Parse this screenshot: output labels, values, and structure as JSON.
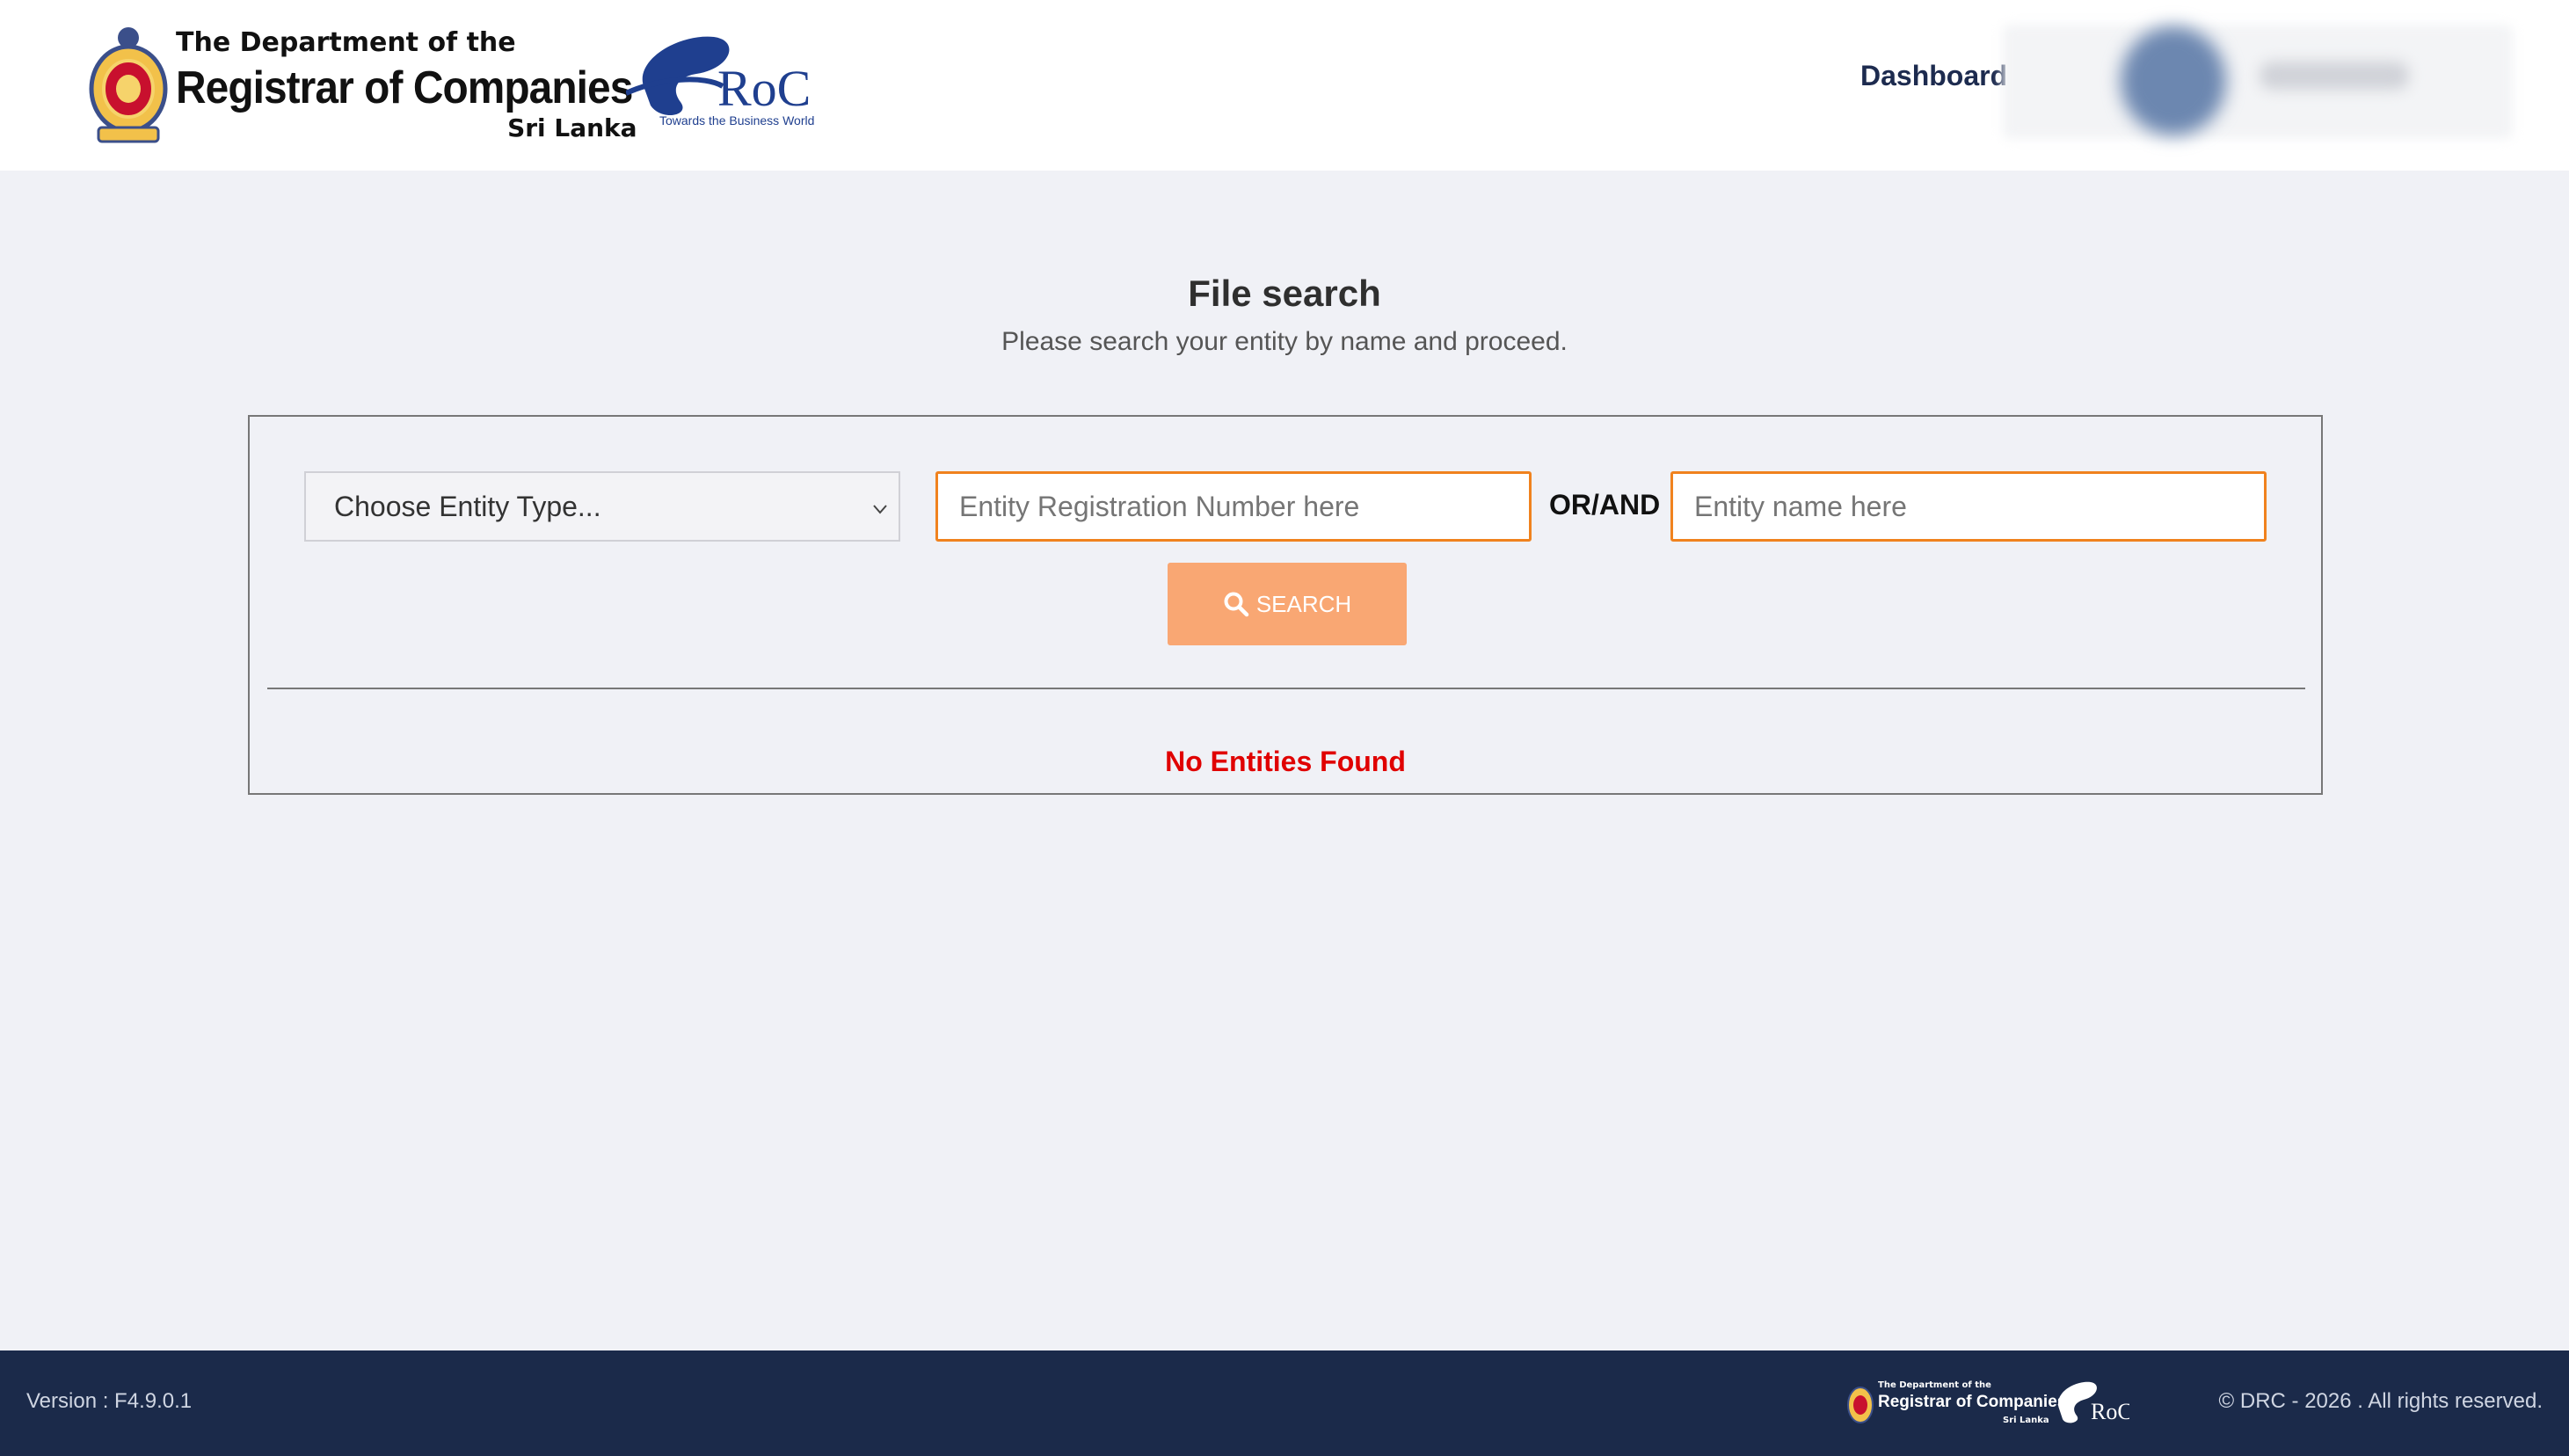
{
  "header": {
    "dept_line1": "The Department of the",
    "dept_line2": "Registrar of Companies",
    "dept_line3": "Sri Lanka",
    "eroc_logo_text": "RoC",
    "eroc_tagline": "Towards the Business World",
    "nav_dashboard": "Dashboard"
  },
  "main": {
    "title": "File search",
    "subtitle": "Please search your entity by name and proceed.",
    "entity_type_select": "Choose Entity Type...",
    "reg_number_placeholder": "Entity Registration Number here",
    "or_and_label": "OR/AND",
    "entity_name_placeholder": "Entity name here",
    "search_button": "SEARCH",
    "result_message": "No Entities Found"
  },
  "footer": {
    "version": "Version : F4.9.0.1",
    "copyright": "© DRC - 2026 . All rights reserved.",
    "logo_line1": "The Department of the",
    "logo_line2": "Registrar of Companies",
    "logo_line3": "Sri Lanka"
  },
  "colors": {
    "accent_orange": "#f0821e",
    "search_button_bg": "#f9a773",
    "footer_bg": "#1b2a4a",
    "error_red": "#e00000",
    "nav_text": "#1d2b4f"
  }
}
